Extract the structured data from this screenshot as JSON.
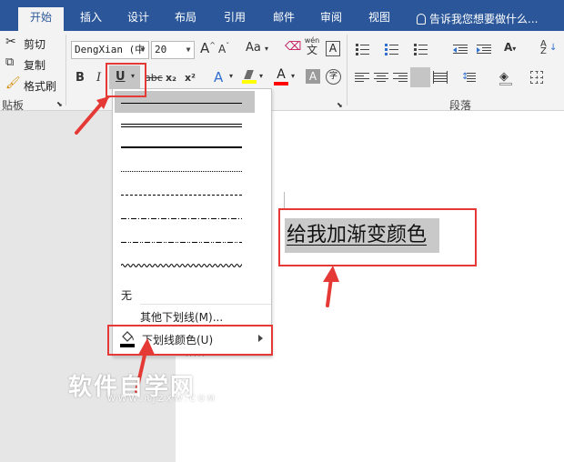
{
  "tabs": [
    {
      "label": "开始",
      "active": true
    },
    {
      "label": "插入",
      "active": false
    },
    {
      "label": "设计",
      "active": false
    },
    {
      "label": "布局",
      "active": false
    },
    {
      "label": "引用",
      "active": false
    },
    {
      "label": "邮件",
      "active": false
    },
    {
      "label": "审阅",
      "active": false
    },
    {
      "label": "视图",
      "active": false
    }
  ],
  "tell_me": "告诉我您想要做什么...",
  "clipboard": {
    "cut": "剪切",
    "copy": "复制",
    "format_painter": "格式刷",
    "group_name": "贴板"
  },
  "font": {
    "name": "DengXian (中",
    "size": "20",
    "bold": "B",
    "italic": "I",
    "underline": "U",
    "strike": "abc",
    "subscript": "x₂",
    "superscript": "x²",
    "change_case": "Aa",
    "grow": "A",
    "shrink": "A",
    "phonetic_top": "wén",
    "phonetic_bottom": "文",
    "border_char": "A",
    "font_color": "A",
    "shade_char": "A",
    "enclose_char": "字"
  },
  "paragraph": {
    "group_name": "段落"
  },
  "colors": {
    "tab_bar": "#2b579a",
    "highlight": "#ffff00",
    "font_color": "#ff0000",
    "annotation": "#e53935"
  },
  "underline_menu": {
    "none": "无",
    "more": "其他下划线(M)...",
    "color": "下划线颜色(U)"
  },
  "document": {
    "text": "给我加渐变颜色"
  },
  "watermark": {
    "title": "软件自学网",
    "url": "WWW.RJZXW.COM"
  }
}
